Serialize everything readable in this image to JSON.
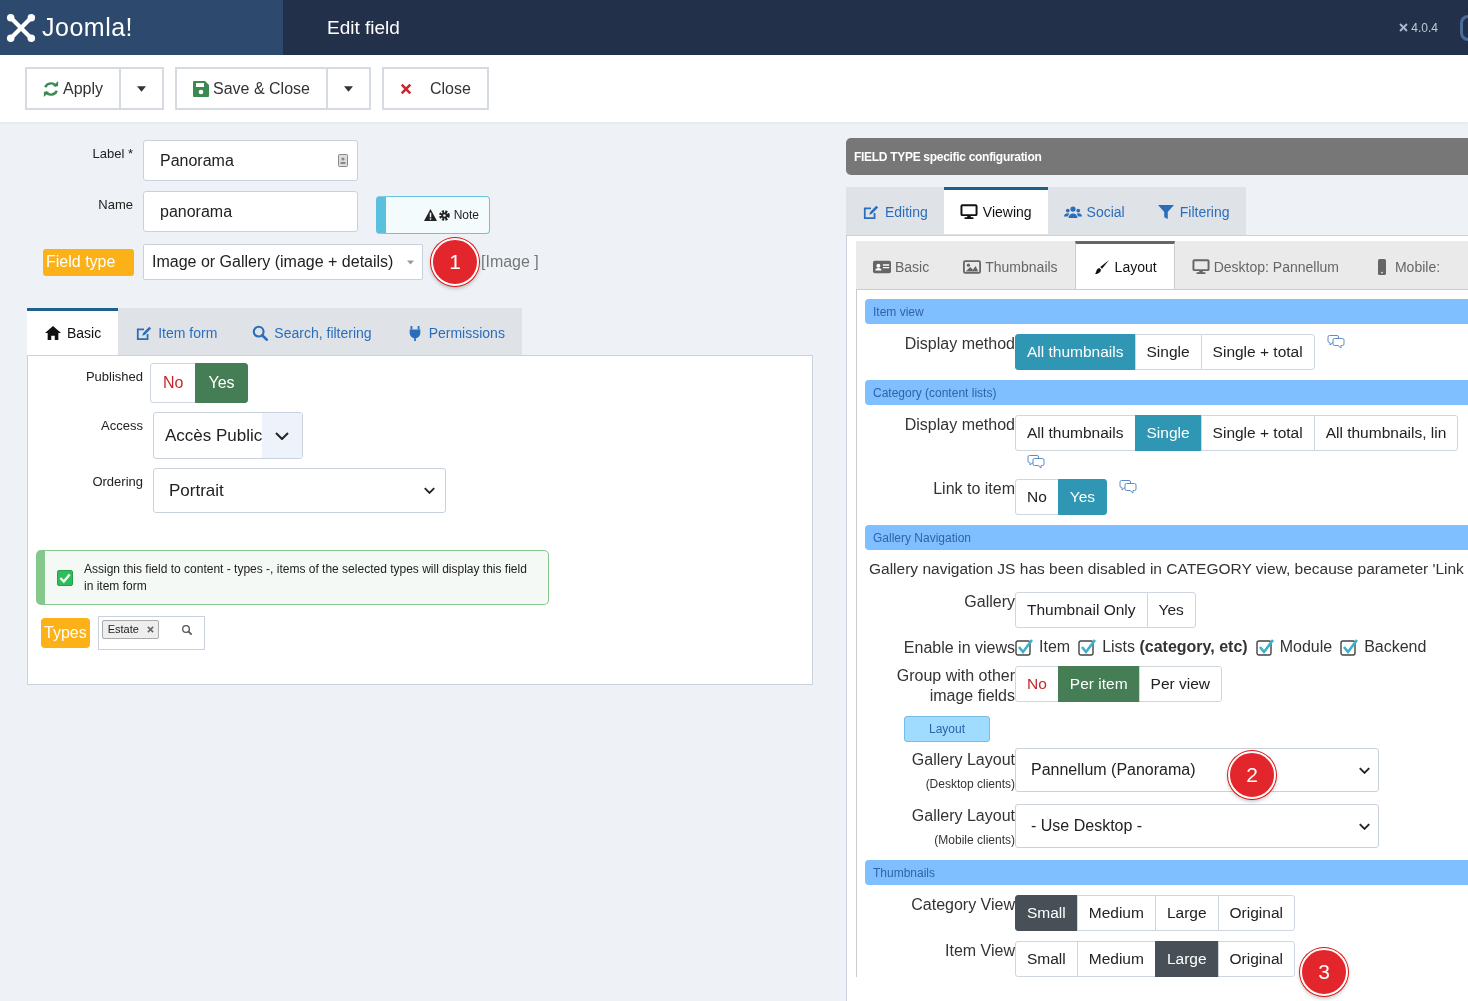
{
  "header": {
    "logo_text": "Joomla!",
    "title": "Edit field",
    "version": "4.0.4"
  },
  "toolbar": [
    {
      "label": "Apply",
      "kind": "apply",
      "split": true
    },
    {
      "label": "Save & Close",
      "kind": "save",
      "split": true
    },
    {
      "label": "Close",
      "kind": "close",
      "split": false
    }
  ],
  "form": {
    "fields": [
      {
        "label": "Label *",
        "value": "Panorama"
      },
      {
        "label": "Name",
        "value": "panorama"
      }
    ],
    "note": "Note",
    "field_type": {
      "label": "Field type",
      "value": "Image or Gallery (image + details)",
      "suffix": "[Image ]"
    }
  },
  "tabs": [
    {
      "label": "Basic",
      "selected": true
    },
    {
      "label": "Item form",
      "selected": false
    },
    {
      "label": "Search, filtering",
      "selected": false
    },
    {
      "label": "Permissions",
      "selected": false
    }
  ],
  "basic": {
    "published": {
      "label": "Published",
      "options": [
        {
          "label": "No",
          "selected": false,
          "danger": true
        },
        {
          "label": "Yes",
          "selected": true,
          "danger": false
        }
      ]
    },
    "access": {
      "label": "Access",
      "value": "Accès Public"
    },
    "ordering": {
      "label": "Ordering",
      "value": "Portrait"
    },
    "assign_notice": {
      "checked": true,
      "text": "Assign this field to content - types -, items of the selected types will display this field in item form"
    },
    "types": {
      "label": "Types",
      "tags": [
        "Estate"
      ]
    }
  },
  "config": {
    "title": "FIELD TYPE specific configuration",
    "tabs": [
      {
        "label": "Editing",
        "selected": false
      },
      {
        "label": "Viewing",
        "selected": true
      },
      {
        "label": "Social",
        "selected": false
      },
      {
        "label": "Filtering",
        "selected": false
      }
    ],
    "subtabs": [
      {
        "label": "Basic",
        "selected": false
      },
      {
        "label": "Thumbnails",
        "selected": false
      },
      {
        "label": "Layout",
        "selected": true
      },
      {
        "label": "Desktop: Pannellum",
        "selected": false
      },
      {
        "label": "Mobile:",
        "selected": false
      }
    ],
    "sections": [
      {
        "title": "Item view",
        "rows": [
          {
            "kind": "radio",
            "label": "Display method",
            "help": true,
            "options": [
              {
                "label": "All thumbnails",
                "selected": true,
                "danger": false
              },
              {
                "label": "Single",
                "selected": false,
                "danger": false
              },
              {
                "label": "Single + total",
                "selected": false,
                "danger": false
              }
            ]
          }
        ]
      },
      {
        "title": "Category (content lists)",
        "rows": [
          {
            "kind": "radio",
            "label": "Display method",
            "help": true,
            "options": [
              {
                "label": "All thumbnails",
                "selected": false,
                "danger": false
              },
              {
                "label": "Single",
                "selected": true,
                "danger": false
              },
              {
                "label": "Single + total",
                "selected": false,
                "danger": false
              },
              {
                "label": "All thumbnails, lin",
                "selected": false,
                "danger": false
              }
            ]
          },
          {
            "kind": "radio",
            "label": "Link to item",
            "help": true,
            "options": [
              {
                "label": "No",
                "selected": false,
                "danger": false
              },
              {
                "label": "Yes",
                "selected": true,
                "danger": false
              }
            ]
          }
        ]
      },
      {
        "title": "Gallery Navigation",
        "rows": [
          {
            "kind": "text",
            "text": "Gallery navigation JS has been disabled in CATEGORY view, because parameter 'Link"
          },
          {
            "kind": "radio",
            "label": "Gallery",
            "options": [
              {
                "label": "Thumbnail Only",
                "selected": false,
                "danger": false
              },
              {
                "label": "Yes",
                "selected": false,
                "danger": false
              }
            ]
          },
          {
            "kind": "checks",
            "label": "Enable in views",
            "items": [
              {
                "label": "Item",
                "checked": true
              },
              {
                "label": "Lists **(category, etc)**",
                "checked": true
              },
              {
                "label": "Module",
                "checked": true
              },
              {
                "label": "Backend",
                "checked": true
              }
            ]
          },
          {
            "kind": "radio",
            "label": "Group with other image fields",
            "options": [
              {
                "label": "No",
                "selected": false,
                "danger": true
              },
              {
                "label": "Per item",
                "selected": true,
                "danger": false
              },
              {
                "label": "Per view",
                "selected": false,
                "danger": false
              }
            ]
          },
          {
            "kind": "subheading",
            "text": "Layout"
          },
          {
            "kind": "select",
            "label": "Gallery Layout",
            "sublabel": "(Desktop clients)",
            "value": "Pannellum (Panorama)"
          },
          {
            "kind": "select",
            "label": "Gallery Layout",
            "sublabel": "(Mobile clients)",
            "value": "- Use Desktop -"
          }
        ]
      },
      {
        "title": "Thumbnails",
        "rows": [
          {
            "kind": "radio",
            "label": "Category View",
            "options": [
              {
                "label": "Small",
                "selected": true,
                "danger": false
              },
              {
                "label": "Medium",
                "selected": false,
                "danger": false
              },
              {
                "label": "Large",
                "selected": false,
                "danger": false
              },
              {
                "label": "Original",
                "selected": false,
                "danger": false
              }
            ]
          },
          {
            "kind": "radio",
            "label": "Item View",
            "options": [
              {
                "label": "Small",
                "selected": false,
                "danger": false
              },
              {
                "label": "Medium",
                "selected": false,
                "danger": false
              },
              {
                "label": "Large",
                "selected": true,
                "danger": false
              },
              {
                "label": "Original",
                "selected": false,
                "danger": false
              }
            ]
          }
        ]
      }
    ]
  },
  "annotations": [
    "1",
    "2",
    "3"
  ]
}
